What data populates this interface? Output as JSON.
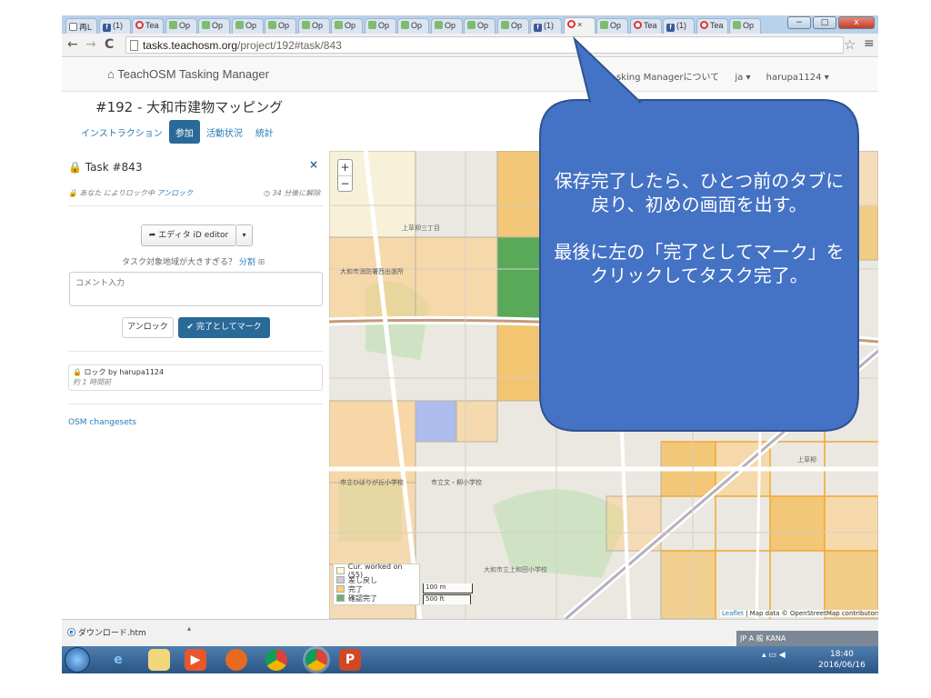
{
  "browser": {
    "tabs": [
      {
        "label": "再L",
        "icon": "doc"
      },
      {
        "label": "(1)",
        "icon": "fb"
      },
      {
        "label": "Tea",
        "icon": "op"
      },
      {
        "label": "Op",
        "icon": "osm"
      },
      {
        "label": "Op",
        "icon": "osm"
      },
      {
        "label": "Op",
        "icon": "osm"
      },
      {
        "label": "Op",
        "icon": "osm"
      },
      {
        "label": "Op",
        "icon": "osm"
      },
      {
        "label": "Op",
        "icon": "osm"
      },
      {
        "label": "Op",
        "icon": "osm"
      },
      {
        "label": "Op",
        "icon": "osm"
      },
      {
        "label": "Op",
        "icon": "osm"
      },
      {
        "label": "Op",
        "icon": "osm"
      },
      {
        "label": "Op",
        "icon": "osm"
      },
      {
        "label": "(1)",
        "icon": "fb"
      },
      {
        "label": "×",
        "icon": "op",
        "active": true
      },
      {
        "label": "Op",
        "icon": "osm"
      },
      {
        "label": "Tea",
        "icon": "op"
      },
      {
        "label": "(1)",
        "icon": "fb"
      },
      {
        "label": "Tea",
        "icon": "op"
      },
      {
        "label": "Op",
        "icon": "osm"
      }
    ],
    "back": "←",
    "forward": "→",
    "reload": "C",
    "url_host": "tasks.teachosm.org",
    "url_path": "/project/192#task/843",
    "star": "☆",
    "menu": "≡",
    "window_buttons": {
      "minimize": "−",
      "maximize": "□",
      "close": "x"
    }
  },
  "app": {
    "brand": "TeachOSM Tasking Manager",
    "about": "sking Managerについて",
    "lang": "ja ▾",
    "user": "harupa1124 ▾"
  },
  "project": {
    "title": "#192 - 大和市建物マッピング",
    "tabs": [
      "インストラクション",
      "参加",
      "活動状況",
      "統計"
    ],
    "active_tab": 1
  },
  "task": {
    "title": "Task #843",
    "close": "×",
    "lock_text": "あなた によりロック中",
    "lock_link": "アンロック",
    "expiry": "34 分後に解除",
    "editor_button": "エディタ iD editor",
    "editor_caret": "▾",
    "split_question": "タスク対象地域が大きすぎる？",
    "split_link": "分割",
    "comment_placeholder": "コメント入力",
    "unlock_button": "アンロック",
    "done_button": "完了としてマーク",
    "history_line1": "ロック by harupa1124",
    "history_line2": "約 1 時間前",
    "changesets": "OSM changesets"
  },
  "map": {
    "zoom_in": "+",
    "zoom_out": "−",
    "legend": [
      {
        "label": "Cur. worked on (55)",
        "color": "#fffbd0"
      },
      {
        "label": "差し戻し",
        "color": "#cccccc"
      },
      {
        "label": "完了",
        "color": "#ffcc80"
      },
      {
        "label": "確認完了",
        "color": "#6db36d"
      }
    ],
    "scale_metric": "100 m",
    "scale_imperial": "500 ft",
    "attribution_leaflet": "Leaflet",
    "attribution_rest": " | Map data © OpenStreetMap contributors",
    "labels": [
      "上草柳三丁目",
      "上草柳",
      "市立ひばりが丘小学校",
      "市立文・柳小学校",
      "大和市消防署西出張所",
      "大和市立上和田小学校"
    ]
  },
  "downloads": {
    "file": "ダウンロード.htm",
    "caret": "▴"
  },
  "taskbar": {
    "ime": "JP  A 般  KANA",
    "time": "18:40",
    "date": "2016/06/16"
  },
  "callout": {
    "line1": "保存完了したら、ひとつ前のタブに戻り、初めの画面を出す。",
    "line2": "最後に左の「完了としてマーク」をクリックしてタスク完了。",
    "colors": {
      "fill": "#4472c4",
      "stroke": "#2f528f"
    }
  }
}
